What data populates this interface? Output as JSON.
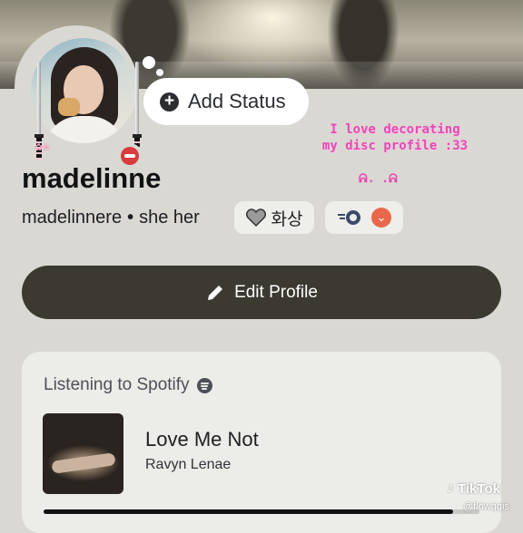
{
  "status": {
    "add_label": "Add Status"
  },
  "decoration": {
    "line1": "I love decorating",
    "line2": "my disc profile :33",
    "face": "ᕱ. .ᕱ"
  },
  "profile": {
    "display_name": "madelinne",
    "username": "madelinnere",
    "separator": "•",
    "pronouns": "she her",
    "tag_text": "화상"
  },
  "actions": {
    "edit_profile": "Edit Profile"
  },
  "spotify": {
    "heading": "Listening to Spotify",
    "track": "Love Me Not",
    "artist": "Ravyn Lenae",
    "progress": 0.94
  },
  "watermark": {
    "brand": "TikTok",
    "handle": "@flowqqis"
  },
  "colors": {
    "dnd_status": "#d83c3e",
    "edit_button": "#3b3930",
    "deco_pink": "#e54bb0",
    "badge_orange": "#e8684c"
  }
}
